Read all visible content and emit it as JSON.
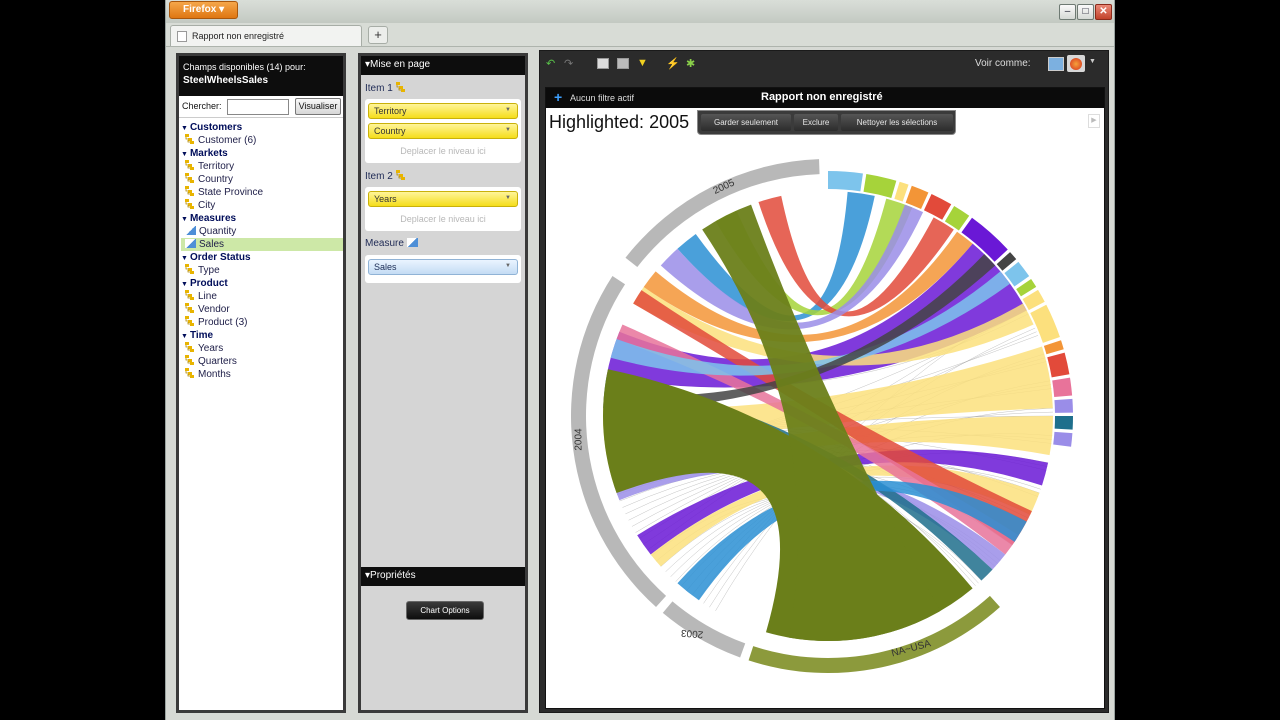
{
  "browser": {
    "menu_label": "Firefox",
    "tab_title": "Rapport non enregistré",
    "new_tab": "+"
  },
  "fields_panel": {
    "header_line1": "Champs disponibles (14) pour:",
    "cube_name": "SteelWheelsSales",
    "search_label": "Chercher:",
    "search_value": "",
    "search_button": "Visualiser",
    "groups": [
      {
        "name": "Customers",
        "items": [
          {
            "label": "Customer (6)",
            "kind": "level"
          }
        ]
      },
      {
        "name": "Markets",
        "items": [
          {
            "label": "Territory",
            "kind": "level"
          },
          {
            "label": "Country",
            "kind": "level"
          },
          {
            "label": "State Province",
            "kind": "level"
          },
          {
            "label": "City",
            "kind": "level"
          }
        ]
      },
      {
        "name": "Measures",
        "items": [
          {
            "label": "Quantity",
            "kind": "measure"
          },
          {
            "label": "Sales",
            "kind": "measure",
            "selected": true
          }
        ]
      },
      {
        "name": "Order Status",
        "items": [
          {
            "label": "Type",
            "kind": "level"
          }
        ]
      },
      {
        "name": "Product",
        "items": [
          {
            "label": "Line",
            "kind": "level"
          },
          {
            "label": "Vendor",
            "kind": "level"
          },
          {
            "label": "Product (3)",
            "kind": "level"
          }
        ]
      },
      {
        "name": "Time",
        "items": [
          {
            "label": "Years",
            "kind": "level"
          },
          {
            "label": "Quarters",
            "kind": "level"
          },
          {
            "label": "Months",
            "kind": "level"
          }
        ]
      }
    ]
  },
  "layout_panel": {
    "header": "Mise en page",
    "item1_label": "Item 1",
    "item1_pills": [
      "Territory",
      "Country"
    ],
    "item1_drop": "Deplacer le niveau ici",
    "item2_label": "Item 2",
    "item2_pills": [
      "Years"
    ],
    "item2_drop": "Deplacer le niveau ici",
    "measure_label": "Measure",
    "measure_pills": [
      "Sales"
    ],
    "properties_header": "Propriétés",
    "chart_options_button": "Chart Options"
  },
  "report": {
    "voir_comme": "Voir comme:",
    "filter_text": "Aucun filtre actif",
    "title": "Rapport non enregistré",
    "highlighted": "Highlighted: 2005",
    "selection_buttons": [
      "Garder seulement",
      "Exclure",
      "Nettoyer les sélections"
    ]
  },
  "chart_data": {
    "type": "chord",
    "title": "",
    "segment_labels": [
      "2005",
      "2004",
      "2003",
      "NA~USA"
    ],
    "highlighted": "2005",
    "colors": {
      "years_arc": "#b8b8b8",
      "usa_arc": "#8c9a3c",
      "usa_ribbon": "#6b7f1a",
      "purple": "#6a18d6",
      "yellow": "#fce07d",
      "blue": "#2a8fd4",
      "green_light": "#a6d33a",
      "red": "#e24a3a",
      "pink": "#e8739a",
      "lavender": "#9a8de8",
      "skyblue": "#7dc4ec",
      "orange": "#f39537",
      "teal": "#1e6f8c",
      "gray_dark": "#444444"
    }
  }
}
